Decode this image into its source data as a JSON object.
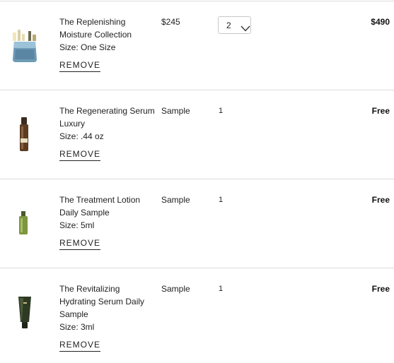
{
  "cart": {
    "items": [
      {
        "name_lines": [
          "The Replenishing",
          "Moisture Collection"
        ],
        "size": "Size: One Size",
        "price": "$245",
        "quantity": "2",
        "total": "$490",
        "remove_label": "REMOVE",
        "image_icon": "skincare-collection-icon"
      },
      {
        "name_lines": [
          "The Regenerating Serum",
          "Luxury"
        ],
        "size": "Size: .44 oz",
        "price": "Sample",
        "quantity": "1",
        "total": "Free",
        "remove_label": "REMOVE",
        "image_icon": "serum-bottle-icon"
      },
      {
        "name_lines": [
          "The Treatment Lotion",
          "Daily Sample"
        ],
        "size": "Size: 5ml",
        "price": "Sample",
        "quantity": "1",
        "total": "Free",
        "remove_label": "REMOVE",
        "image_icon": "lotion-bottle-icon"
      },
      {
        "name_lines": [
          "The Revitalizing",
          "Hydrating Serum Daily",
          "Sample"
        ],
        "size": "Size: 3ml",
        "price": "Sample",
        "quantity": "1",
        "total": "Free",
        "remove_label": "REMOVE",
        "image_icon": "tube-icon"
      }
    ]
  }
}
